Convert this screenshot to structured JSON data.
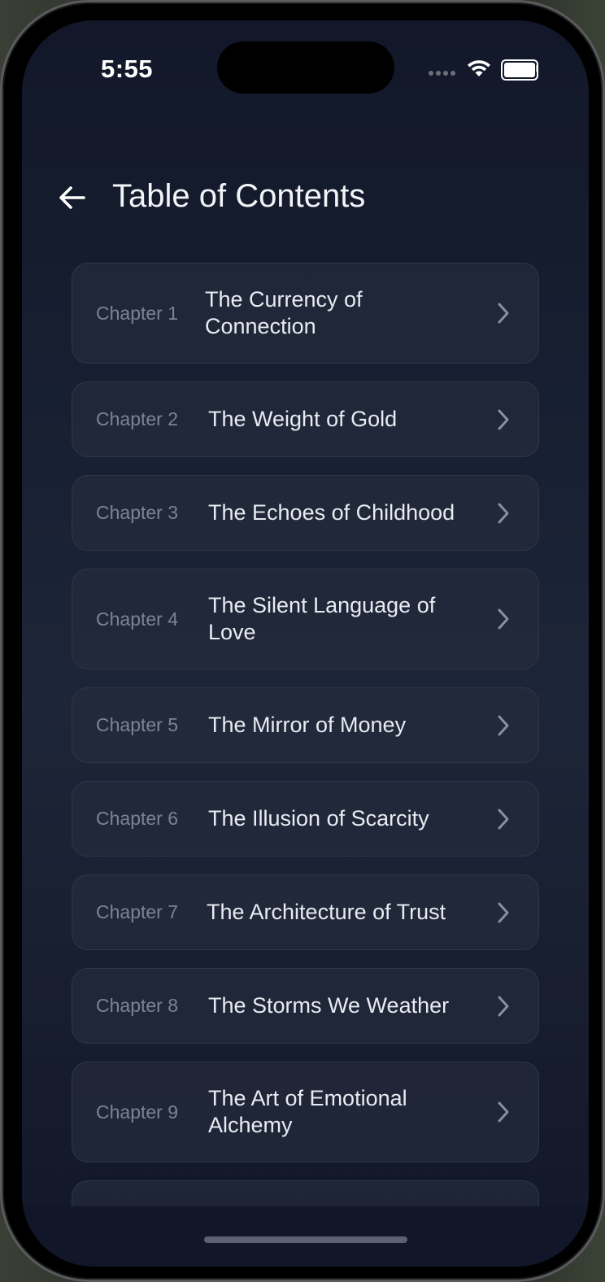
{
  "status_bar": {
    "time": "5:55",
    "icons": [
      "cellular-signal-icon",
      "wifi-icon",
      "battery-icon"
    ]
  },
  "header": {
    "back_icon": "arrow-left-icon",
    "title": "Table of Contents"
  },
  "chapters": [
    {
      "label": "Chapter 1",
      "title": "The Currency of Connection"
    },
    {
      "label": "Chapter 2",
      "title": "The Weight of Gold"
    },
    {
      "label": "Chapter 3",
      "title": "The Echoes of Childhood"
    },
    {
      "label": "Chapter 4",
      "title": "The Silent Language of Love"
    },
    {
      "label": "Chapter 5",
      "title": "The Mirror of Money"
    },
    {
      "label": "Chapter 6",
      "title": "The Illusion of Scarcity"
    },
    {
      "label": "Chapter 7",
      "title": "The Architecture of Trust"
    },
    {
      "label": "Chapter 8",
      "title": "The Storms We Weather"
    },
    {
      "label": "Chapter 9",
      "title": "The Art of Emotional Alchemy"
    }
  ],
  "colors": {
    "background": "#161c2d",
    "card": "#242b3c",
    "card_border": "#2e3648",
    "title_text": "#e8ebf1",
    "chapter_label": "#7c8394",
    "chevron": "#8a909c"
  }
}
